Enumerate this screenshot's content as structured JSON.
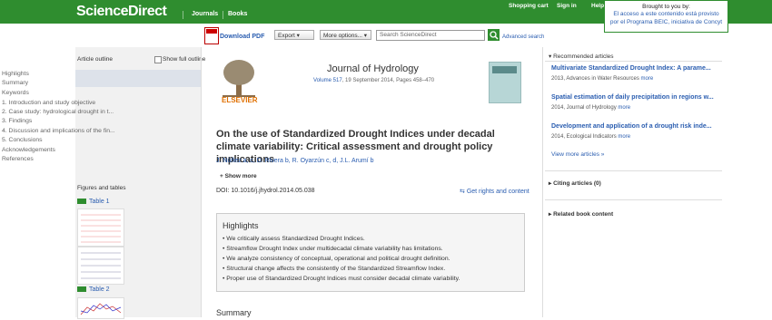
{
  "header": {
    "logo": "ScienceDirect",
    "nav": [
      "Journals",
      "Books"
    ],
    "links": [
      "Shopping cart",
      "Sign in",
      "Help"
    ],
    "brought_title": "Brought to you by:",
    "brought_line1": "El acceso a este contenido está provisto",
    "brought_line2": "por el Programa BEIC, iniciativa de Concyt"
  },
  "toolbar": {
    "download_pdf": "Download PDF",
    "export": "Export",
    "more_options": "More options...",
    "search_placeholder": "Search ScienceDirect",
    "advanced_search": "Advanced search"
  },
  "outline": {
    "heading": "Article outline",
    "show_full": "Show full outline",
    "items": [
      "Highlights",
      "Summary",
      "Keywords",
      "1. Introduction and study objective",
      "2. Case study: hydrological drought in t...",
      "3. Findings",
      "4. Discussion and implications of the fin...",
      "5. Conclusions",
      "Acknowledgements",
      "References"
    ],
    "figures_heading": "Figures and tables",
    "tables": [
      "Table 1",
      "Table 2"
    ]
  },
  "article": {
    "journal": "Journal of Hydrology",
    "volume": "Volume 517",
    "date_pages": ", 19 September 2014, Pages 458–470",
    "publisher": "ELSEVIER",
    "title": "On the use of Standardized Drought Indices under decadal climate variability: Critical assessment and drought policy implications",
    "authors": "J. Núñez a, c,   D. Rivera b,  R. Oyarzún c, d,  J.L. Arumí b",
    "show_more": "Show more",
    "doi": "DOI: 10.1016/j.jhydrol.2014.05.038",
    "rights": "Get rights and content",
    "highlights_heading": "Highlights",
    "highlights": [
      "We critically assess Standardized Drought Indices.",
      "Streamflow Drought Index under multidecadal climate variability has limitations.",
      "We analyze consistency of conceptual, operational and political drought definition.",
      "Structural change affects the consistently of the Standardized Streamflow Index.",
      "Proper use of Standardized Drought Indices must consider decadal climate variability."
    ],
    "summary_heading": "Summary"
  },
  "sidebar": {
    "recommended_heading": "Recommended articles",
    "items": [
      {
        "title": "Multivariate Standardized Drought Index: A parame...",
        "meta": "2013, Advances in Water Resources",
        "more": "more"
      },
      {
        "title": "Spatial estimation of daily precipitation in regions w...",
        "meta": "2014, Journal of Hydrology",
        "more": "more"
      },
      {
        "title": "Development and application of a drought risk inde...",
        "meta": "2014, Ecological Indicators",
        "more": "more"
      }
    ],
    "view_more": "View more articles »",
    "citing": "Citing articles (0)",
    "related": "Related book content"
  }
}
